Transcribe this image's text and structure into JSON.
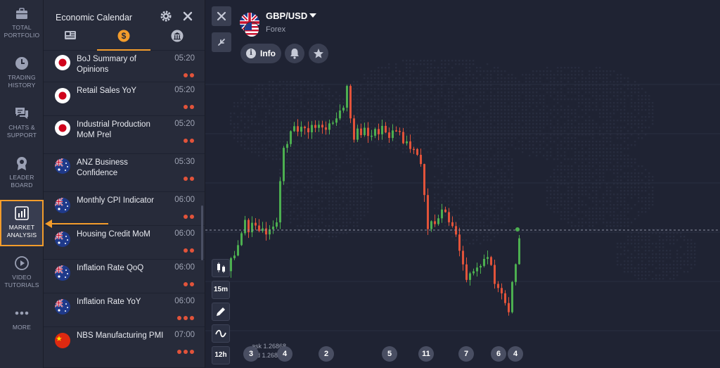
{
  "nav": {
    "items": [
      {
        "label": "TOTAL\nPORTFOLIO",
        "icon": "briefcase-icon"
      },
      {
        "label": "TRADING\nHISTORY",
        "icon": "clock-icon"
      },
      {
        "label": "CHATS &\nSUPPORT",
        "icon": "chat-icon"
      },
      {
        "label": "LEADER\nBOARD",
        "icon": "medal-icon"
      },
      {
        "label": "MARKET\nANALYSIS",
        "icon": "bar-chart-icon",
        "active": true
      },
      {
        "label": "VIDEO\nTUTORIALS",
        "icon": "play-icon"
      },
      {
        "label": "MORE",
        "icon": "more-dots-icon"
      }
    ]
  },
  "calendar": {
    "title": "Economic Calendar",
    "tabs": [
      {
        "name": "news-tab",
        "icon": "newspaper-icon"
      },
      {
        "name": "calendar-tab",
        "icon": "dollar-icon",
        "active": true
      },
      {
        "name": "bank-tab",
        "icon": "bank-icon"
      }
    ],
    "events": [
      {
        "name": "BoJ Summary of Opinions",
        "time": "05:20",
        "impact": 2,
        "flag": "japan"
      },
      {
        "name": "Retail Sales YoY",
        "time": "05:20",
        "impact": 2,
        "flag": "japan"
      },
      {
        "name": "Industrial Production MoM Prel",
        "time": "05:20",
        "impact": 2,
        "flag": "japan"
      },
      {
        "name": "ANZ Business Confidence",
        "time": "05:30",
        "impact": 2,
        "flag": "australia"
      },
      {
        "name": "Monthly CPI Indicator",
        "time": "06:00",
        "impact": 2,
        "flag": "australia"
      },
      {
        "name": "Housing Credit MoM",
        "time": "06:00",
        "impact": 2,
        "flag": "australia"
      },
      {
        "name": "Inflation Rate QoQ",
        "time": "06:00",
        "impact": 2,
        "flag": "australia"
      },
      {
        "name": "Inflation Rate YoY",
        "time": "06:00",
        "impact": 3,
        "flag": "australia"
      },
      {
        "name": "NBS Manufacturing PMI",
        "time": "07:00",
        "impact": 3,
        "flag": "china"
      }
    ]
  },
  "asset": {
    "name": "GBP/USD",
    "category": "Forex",
    "info_label": "Info"
  },
  "tools": {
    "timeframe": "15m",
    "period": "12h"
  },
  "prices": {
    "ask": "ask 1.26868",
    "bid": "bid 1.26868"
  },
  "news_badges": [
    "3",
    "4",
    "2",
    "5",
    "11",
    "7",
    "6",
    "4"
  ],
  "colors": {
    "accent": "#f39c2b",
    "bull": "#4caf50",
    "bear": "#e2533a",
    "impact": "#e2533a"
  }
}
